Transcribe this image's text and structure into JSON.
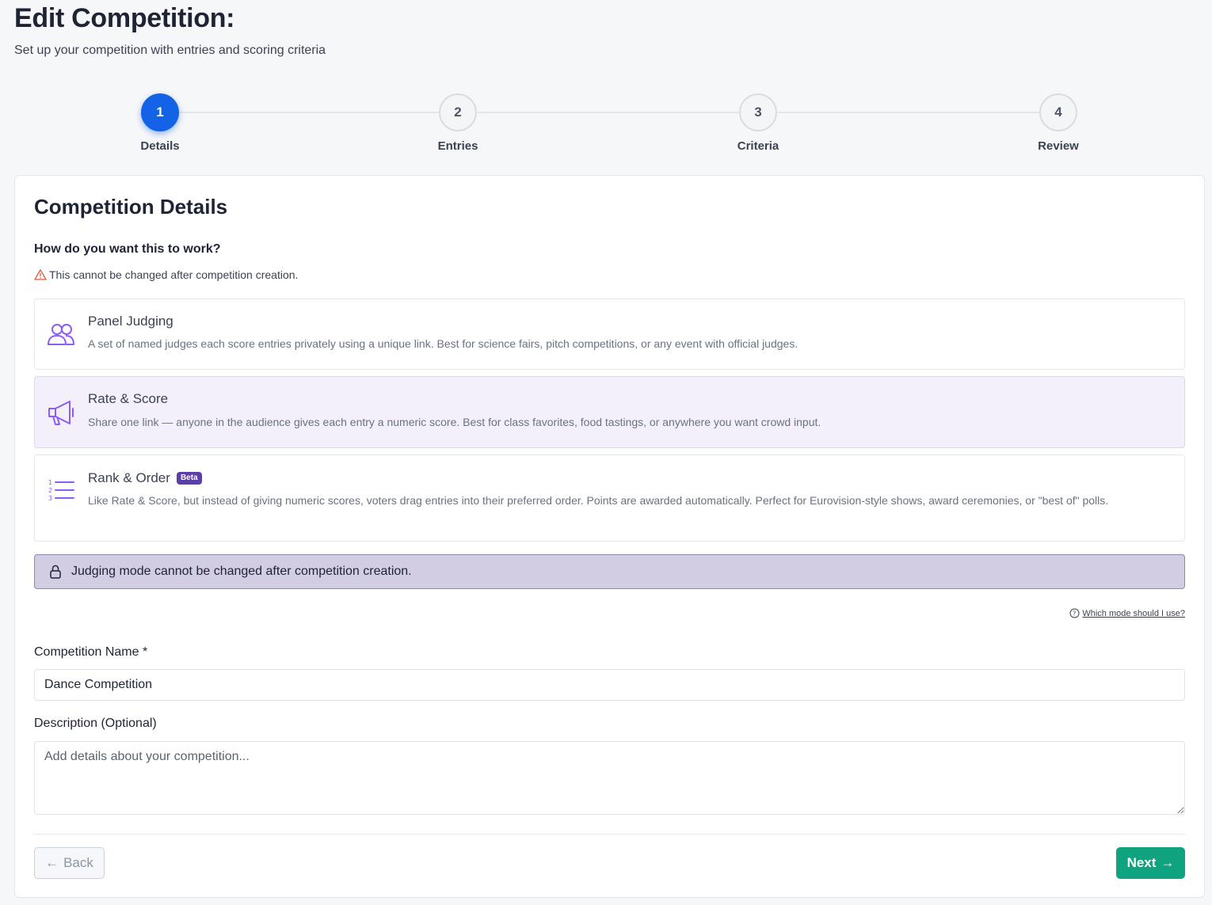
{
  "header": {
    "title": "Edit Competition:",
    "subtitle": "Set up your competition with entries and scoring criteria"
  },
  "stepper": {
    "steps": [
      {
        "number": "1",
        "label": "Details",
        "active": true
      },
      {
        "number": "2",
        "label": "Entries",
        "active": false
      },
      {
        "number": "3",
        "label": "Criteria",
        "active": false
      },
      {
        "number": "4",
        "label": "Review",
        "active": false
      }
    ]
  },
  "card": {
    "title": "Competition Details",
    "question": "How do you want this to work?",
    "warning": "This cannot be changed after competition creation.",
    "modes": [
      {
        "title": "Panel Judging",
        "icon": "users-icon",
        "description": "A set of named judges each score entries privately using a unique link. Best for science fairs, pitch competitions, or any event with official judges.",
        "selected": false
      },
      {
        "title": "Rate & Score",
        "icon": "megaphone-icon",
        "description": "Share one link — anyone in the audience gives each entry a numeric score. Best for class favorites, food tastings, or anywhere you want crowd input.",
        "selected": true
      },
      {
        "title": "Rank & Order",
        "icon": "numbered-list-icon",
        "badge": "Beta",
        "description": "Like Rate & Score, but instead of giving numeric scores, voters drag entries into their preferred order. Points are awarded automatically. Perfect for Eurovision-style shows, award ceremonies, or \"best of\" polls.",
        "selected": false
      }
    ],
    "lock_notice": "Judging mode cannot be changed after competition creation.",
    "help_link": "Which mode should I use?",
    "name_label": "Competition Name *",
    "name_value": "Dance Competition",
    "description_label": "Description (Optional)",
    "description_placeholder": "Add details about your competition..."
  },
  "footer": {
    "back_label": "Back",
    "next_label": "Next"
  },
  "colors": {
    "primary": "#1463e6",
    "accent_purple": "#8b5cf6",
    "success": "#10a37f",
    "selected_bg": "#f3f0fc",
    "lock_bg": "#d3cde4"
  }
}
